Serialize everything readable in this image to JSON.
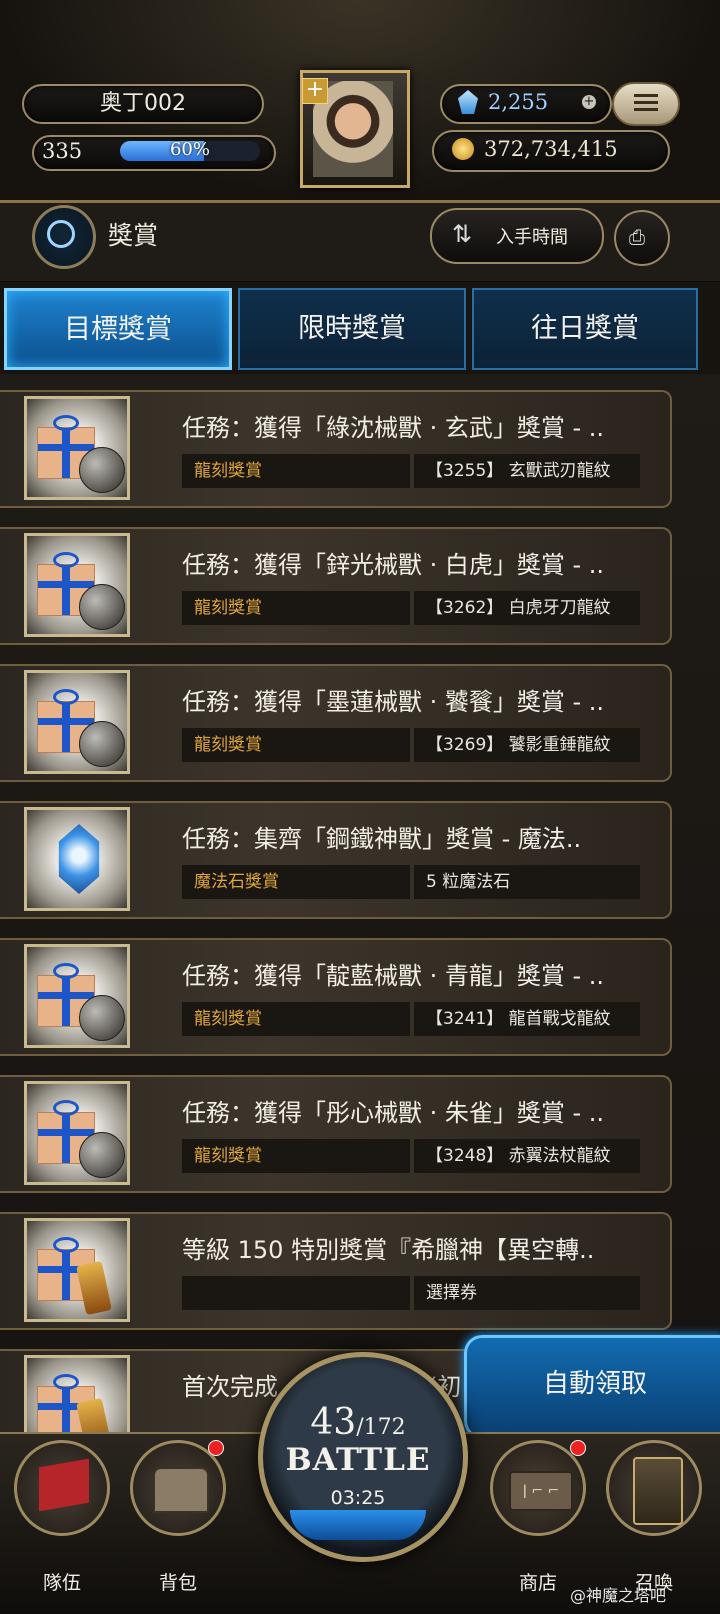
{
  "header": {
    "player_name": "奥丁002",
    "level": "335",
    "exp_percent_label": "60%",
    "exp_fraction": 0.6,
    "gems": "2,255",
    "gold": "372,734,415",
    "plus": "+"
  },
  "titlebar": {
    "title": "獎賞",
    "sort_label": "入手時間",
    "sort_icon": "⇅",
    "camera_icon": "⎙"
  },
  "tabs": [
    {
      "label": "目標獎賞",
      "active": true
    },
    {
      "label": "限時獎賞",
      "active": false
    },
    {
      "label": "往日獎賞",
      "active": false
    }
  ],
  "rewards": [
    {
      "title": "任務：獲得「綠沈械獸 · 玄武」獎賞 - ..",
      "tag": "龍刻獎賞",
      "item": "【3255】 玄獸武刃龍紋",
      "icon": "gift-orb"
    },
    {
      "title": "任務：獲得「鋅光械獸 · 白虎」獎賞 - ..",
      "tag": "龍刻獎賞",
      "item": "【3262】 白虎牙刀龍紋",
      "icon": "gift-orb"
    },
    {
      "title": "任務：獲得「墨蓮械獸 · 饕餮」獎賞 - ..",
      "tag": "龍刻獎賞",
      "item": "【3269】 饕影重錘龍紋",
      "icon": "gift-orb"
    },
    {
      "title": "任務：集齊「鋼鐵神獸」獎賞 - 魔法..",
      "tag": "魔法石獎賞",
      "item": "5 粒魔法石",
      "icon": "magic-stone"
    },
    {
      "title": "任務：獲得「靛藍械獸 · 青龍」獎賞 - ..",
      "tag": "龍刻獎賞",
      "item": "【3241】 龍首戰戈龍紋",
      "icon": "gift-orb"
    },
    {
      "title": "任務：獲得「彤心械獸 · 朱雀」獎賞 - ..",
      "tag": "龍刻獎賞",
      "item": "【3248】 赤翼法杖龍紋",
      "icon": "gift-orb"
    },
    {
      "title": "等級 150 特別獎賞『希臘神【異空轉..",
      "tag": "",
      "item": "選擇券",
      "icon": "gift-scroll"
    },
    {
      "title": "首次完成",
      "tag": "",
      "item": "",
      "icon": "gift-scroll",
      "partial_suffix": "(初"
    }
  ],
  "auto_collect_label": "自動領取",
  "nav": {
    "team": "隊伍",
    "bag": "背包",
    "shop": "商店",
    "summon": "召喚",
    "battle": {
      "count": "43",
      "max": "/172",
      "label": "BATTLE",
      "timer": "03:25"
    }
  },
  "watermark": "@神魔之塔吧"
}
